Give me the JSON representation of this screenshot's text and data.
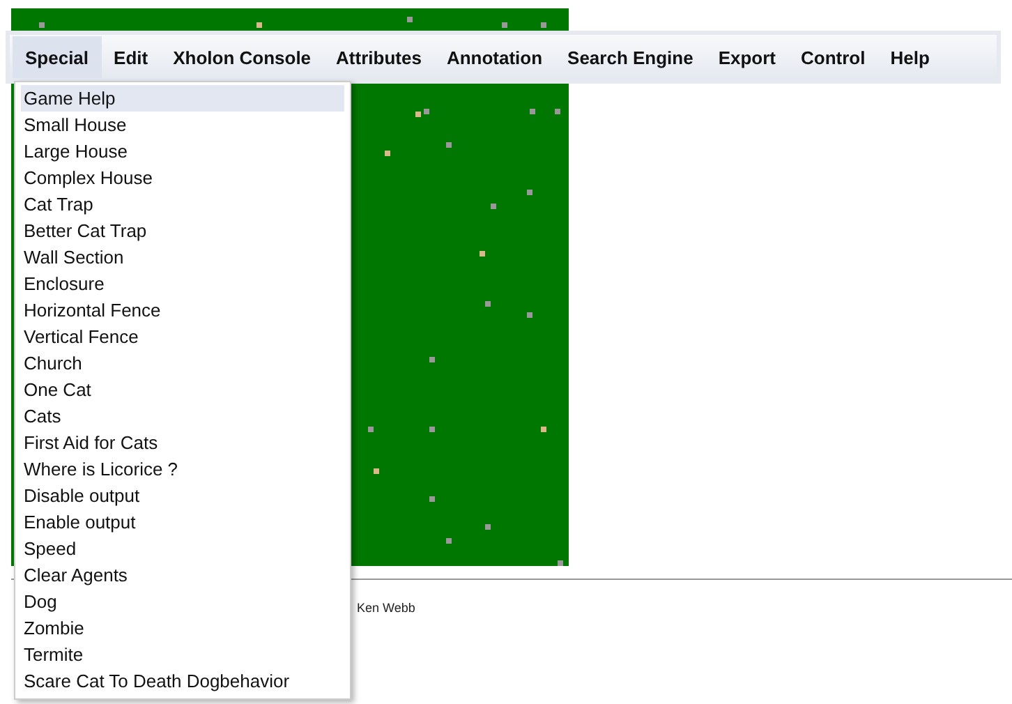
{
  "menu_bar": [
    {
      "label": "Special",
      "selected": true
    },
    {
      "label": "Edit",
      "selected": false
    },
    {
      "label": "Xholon Console",
      "selected": false
    },
    {
      "label": "Attributes",
      "selected": false
    },
    {
      "label": "Annotation",
      "selected": false
    },
    {
      "label": "Search Engine",
      "selected": false
    },
    {
      "label": "Export",
      "selected": false
    },
    {
      "label": "Control",
      "selected": false
    },
    {
      "label": "Help",
      "selected": false
    }
  ],
  "dropdown": [
    {
      "label": "Game Help",
      "selected": true
    },
    {
      "label": "Small House",
      "selected": false
    },
    {
      "label": "Large House",
      "selected": false
    },
    {
      "label": "Complex House",
      "selected": false
    },
    {
      "label": "Cat Trap",
      "selected": false
    },
    {
      "label": "Better Cat Trap",
      "selected": false
    },
    {
      "label": "Wall Section",
      "selected": false
    },
    {
      "label": "Enclosure",
      "selected": false
    },
    {
      "label": "Horizontal Fence",
      "selected": false
    },
    {
      "label": "Vertical Fence",
      "selected": false
    },
    {
      "label": "Church",
      "selected": false
    },
    {
      "label": "One Cat",
      "selected": false
    },
    {
      "label": "Cats",
      "selected": false
    },
    {
      "label": "First Aid for Cats",
      "selected": false
    },
    {
      "label": "Where is Licorice ?",
      "selected": false
    },
    {
      "label": "Disable output",
      "selected": false
    },
    {
      "label": "Enable output",
      "selected": false
    },
    {
      "label": "Speed",
      "selected": false
    },
    {
      "label": "Clear Agents",
      "selected": false
    },
    {
      "label": "Dog",
      "selected": false
    },
    {
      "label": "Zombie",
      "selected": false
    },
    {
      "label": "Termite",
      "selected": false
    },
    {
      "label": "Scare Cat To Death Dogbehavior",
      "selected": false
    }
  ],
  "footer": {
    "author": "Ken Webb"
  }
}
